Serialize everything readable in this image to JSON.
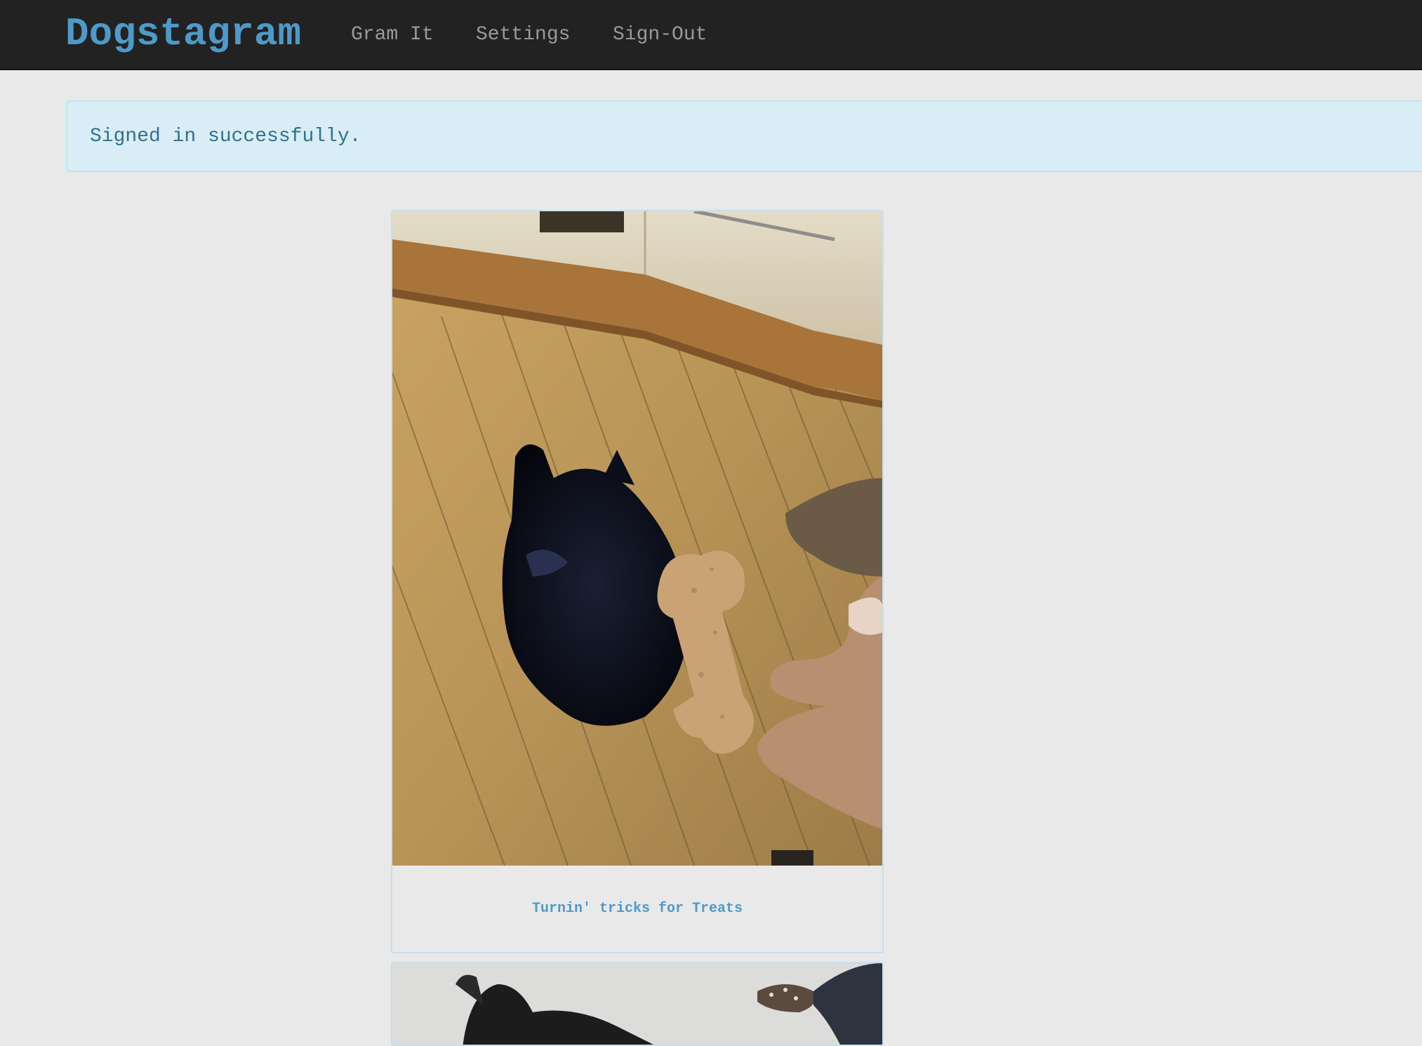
{
  "navbar": {
    "brand": "Dogstagram",
    "links": [
      "Gram It",
      "Settings",
      "Sign-Out"
    ]
  },
  "flash": {
    "message": "Signed in successfully."
  },
  "posts": [
    {
      "caption": "Turnin' tricks for Treats",
      "photo": "black scottish terrier on wooden kitchen floor being offered a bone-shaped dog treat"
    },
    {
      "caption": "",
      "photo": "black dog in snow"
    }
  ],
  "colors": {
    "navbar_bg": "#222222",
    "brand": "#4d9ac8",
    "nav_link": "#9a9a9a",
    "page_bg": "#e9e9e9",
    "alert_bg": "#d9edf7",
    "alert_border": "#bce8f1",
    "alert_text": "#31708f",
    "caption": "#4d9ac8"
  }
}
